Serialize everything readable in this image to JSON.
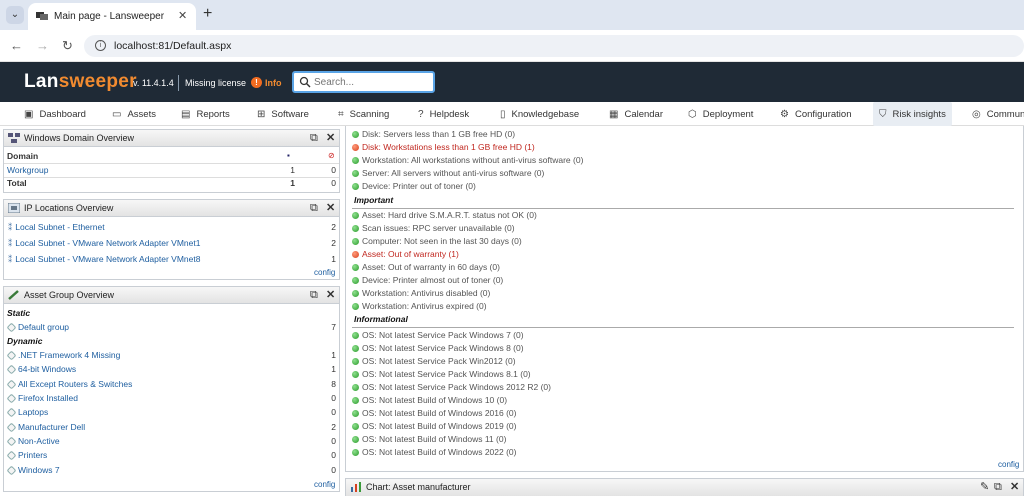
{
  "browser": {
    "tab_title": "Main page - Lansweeper",
    "new_tab": "+",
    "url": "localhost:81/Default.aspx"
  },
  "header": {
    "logo_prefix": "Lan",
    "logo_accent": "sweeper",
    "version": "v. 11.4.1.4",
    "license": "Missing license",
    "info_label": "Info",
    "search_placeholder": "Search..."
  },
  "nav": [
    {
      "label": "Dashboard",
      "icon": "dashboard-icon"
    },
    {
      "label": "Assets",
      "icon": "monitor-icon"
    },
    {
      "label": "Reports",
      "icon": "reports-icon"
    },
    {
      "label": "Software",
      "icon": "software-icon"
    },
    {
      "label": "Scanning",
      "icon": "scanning-icon"
    },
    {
      "label": "Helpdesk",
      "icon": "helpdesk-icon"
    },
    {
      "label": "Knowledgebase",
      "icon": "knowledgebase-icon"
    },
    {
      "label": "Calendar",
      "icon": "calendar-icon"
    },
    {
      "label": "Deployment",
      "icon": "deployment-icon"
    },
    {
      "label": "Configuration",
      "icon": "configuration-icon"
    },
    {
      "label": "Risk insights",
      "icon": "shield-icon"
    },
    {
      "label": "Commun",
      "icon": "community-icon"
    }
  ],
  "domain_panel": {
    "title": "Windows Domain Overview",
    "header": "Domain",
    "rows": [
      {
        "name": "Workgroup",
        "a": "1",
        "b": "0"
      }
    ],
    "total": {
      "name": "Total",
      "a": "1",
      "b": "0"
    }
  },
  "ip_panel": {
    "title": "IP Locations Overview",
    "rows": [
      {
        "name": "Local Subnet - Ethernet",
        "count": "2"
      },
      {
        "name": "Local Subnet - VMware Network Adapter VMnet1",
        "count": "2"
      },
      {
        "name": "Local Subnet - VMware Network Adapter VMnet8",
        "count": "1"
      }
    ],
    "config": "config"
  },
  "group_panel": {
    "title": "Asset Group Overview",
    "static_label": "Static",
    "static_rows": [
      {
        "name": "Default group",
        "count": "7"
      }
    ],
    "dynamic_label": "Dynamic",
    "dynamic_rows": [
      {
        "name": ".NET Framework 4 Missing",
        "count": "1"
      },
      {
        "name": "64-bit Windows",
        "count": "1"
      },
      {
        "name": "All Except Routers & Switches",
        "count": "8"
      },
      {
        "name": "Firefox Installed",
        "count": "0"
      },
      {
        "name": "Laptops",
        "count": "0"
      },
      {
        "name": "Manufacturer Dell",
        "count": "2"
      },
      {
        "name": "Non-Active",
        "count": "0"
      },
      {
        "name": "Printers",
        "count": "0"
      },
      {
        "name": "Windows 7",
        "count": "0"
      }
    ],
    "config": "config"
  },
  "reports": {
    "top": [
      {
        "text": "Disk: Servers less than 1 GB free HD (0)",
        "status": "ok"
      },
      {
        "text": "Disk: Workstations less than 1 GB free HD (1)",
        "status": "bad"
      },
      {
        "text": "Workstation: All workstations without anti-virus software (0)",
        "status": "ok"
      },
      {
        "text": "Server: All servers without anti-virus software (0)",
        "status": "ok"
      },
      {
        "text": "Device: Printer out of toner (0)",
        "status": "ok"
      }
    ],
    "important_label": "Important",
    "important": [
      {
        "text": "Asset: Hard drive S.M.A.R.T. status not OK (0)",
        "status": "ok"
      },
      {
        "text": "Scan issues: RPC server unavailable (0)",
        "status": "ok"
      },
      {
        "text": "Computer: Not seen in the last 30 days (0)",
        "status": "ok"
      },
      {
        "text": "Asset: Out of warranty (1)",
        "status": "bad"
      },
      {
        "text": "Asset: Out of warranty in 60 days (0)",
        "status": "ok"
      },
      {
        "text": "Device: Printer almost out of toner (0)",
        "status": "ok"
      },
      {
        "text": "Workstation: Antivirus disabled (0)",
        "status": "ok"
      },
      {
        "text": "Workstation: Antivirus expired (0)",
        "status": "ok"
      }
    ],
    "informational_label": "Informational",
    "informational": [
      {
        "text": "OS: Not latest Service Pack Windows 7 (0)",
        "status": "ok"
      },
      {
        "text": "OS: Not latest Service Pack Windows 8 (0)",
        "status": "ok"
      },
      {
        "text": "OS: Not latest Service Pack Win2012 (0)",
        "status": "ok"
      },
      {
        "text": "OS: Not latest Service Pack Windows 8.1 (0)",
        "status": "ok"
      },
      {
        "text": "OS: Not latest Service Pack Windows 2012 R2 (0)",
        "status": "ok"
      },
      {
        "text": "OS: Not latest Build of Windows 10 (0)",
        "status": "ok"
      },
      {
        "text": "OS: Not latest Build of Windows 2016 (0)",
        "status": "ok"
      },
      {
        "text": "OS: Not latest Build of Windows 2019 (0)",
        "status": "ok"
      },
      {
        "text": "OS: Not latest Build of Windows 11 (0)",
        "status": "ok"
      },
      {
        "text": "OS: Not latest Build of Windows 2022 (0)",
        "status": "ok"
      }
    ],
    "config": "config"
  },
  "chart_panel": {
    "title": "Chart: Asset manufacturer"
  }
}
